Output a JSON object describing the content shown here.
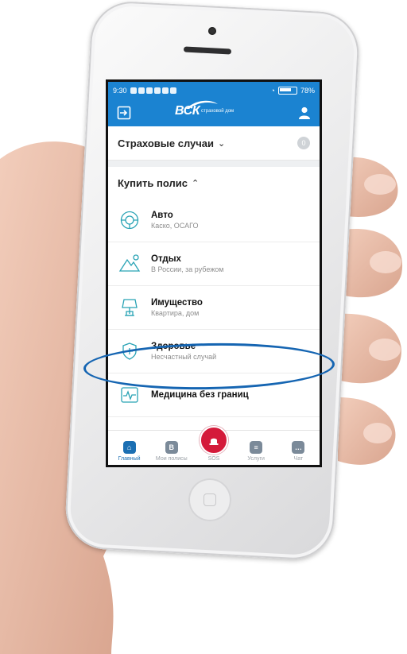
{
  "status": {
    "time": "9:30",
    "battery": "78%"
  },
  "header": {
    "brand": "ВСК",
    "brand_sub": "страховой дом"
  },
  "insurance_cases": {
    "title": "Страховые случаи",
    "count": "0"
  },
  "buy_policy": {
    "title": "Купить полис"
  },
  "items": [
    {
      "title": "Авто",
      "subtitle": "Каско, ОСАГО"
    },
    {
      "title": "Отдых",
      "subtitle": "В России, за рубежом"
    },
    {
      "title": "Имущество",
      "subtitle": "Квартира, дом"
    },
    {
      "title": "Здоровье",
      "subtitle": "Несчастный случай"
    },
    {
      "title": "Медицина без границ",
      "subtitle": ""
    }
  ],
  "tabs": {
    "home": "Главный",
    "policies": "Мои полисы",
    "sos": "SOS",
    "services": "Услуги",
    "chat": "Чат",
    "policies_glyph": "В"
  },
  "colors": {
    "brand_blue": "#1b83d1",
    "sos_red": "#d41a3a",
    "highlight": "#1565b2"
  }
}
